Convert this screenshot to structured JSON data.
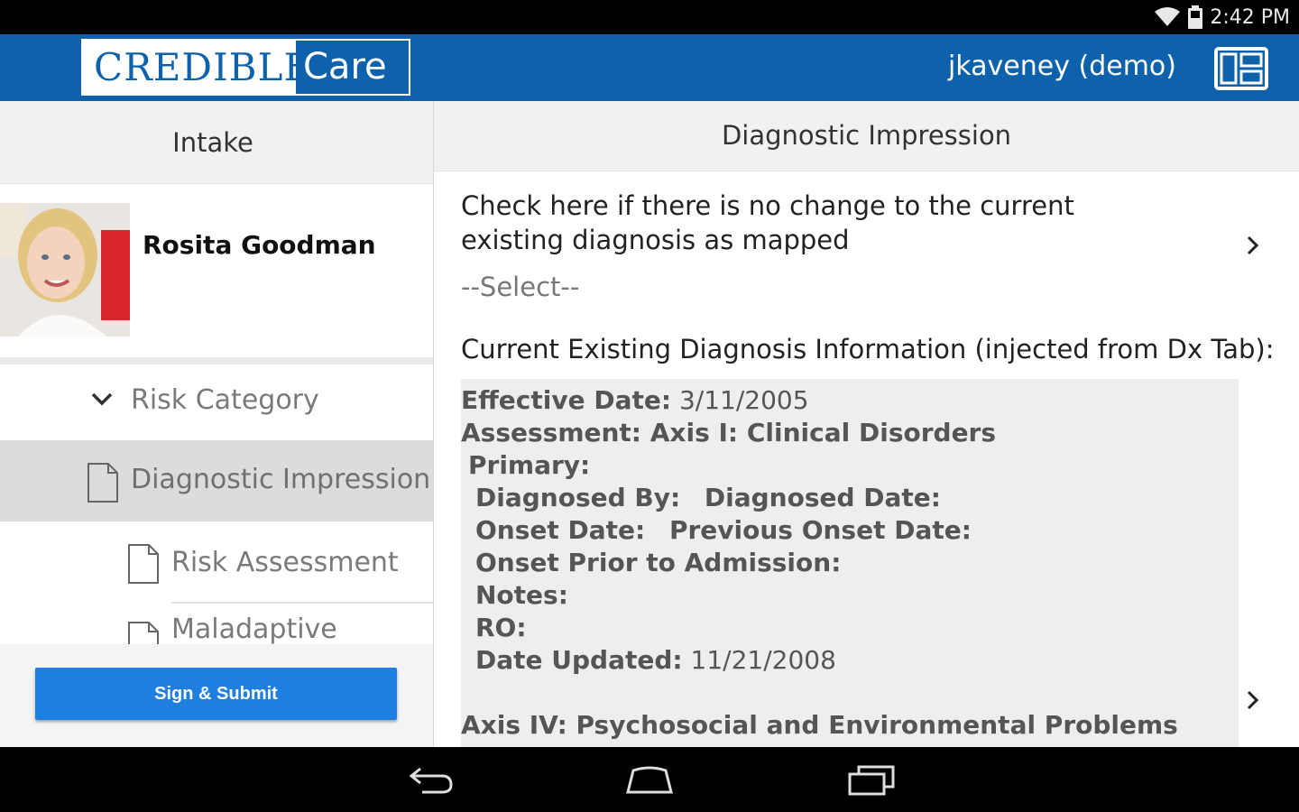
{
  "status_bar": {
    "time": "2:42 PM",
    "icons": [
      "wifi-icon",
      "battery-icon"
    ]
  },
  "app_bar": {
    "logo_left": "CREDIBLE",
    "logo_right": "Care",
    "username": "jkaveney (demo)",
    "layout_icon": "split-layout-icon"
  },
  "left_panel": {
    "header": "Intake",
    "patient": {
      "name": "Rosita Goodman"
    },
    "nav": [
      {
        "label": "Risk Category",
        "icon": "chevron-down-icon"
      },
      {
        "label": "Diagnostic Impression",
        "icon": "document-icon",
        "selected": true
      },
      {
        "label": "Risk Assessment",
        "icon": "document-icon"
      },
      {
        "label": "Maladaptive",
        "icon": "document-icon"
      }
    ],
    "submit_label": "Sign & Submit"
  },
  "right_panel": {
    "header": "Diagnostic Impression",
    "question": "Check here if there is no change to the current existing diagnosis as mapped",
    "select_value": "--Select--",
    "current_label": "Current Existing Diagnosis Information (injected from Dx Tab):",
    "dx": {
      "effective_label": "Effective Date:",
      "effective_value": "3/11/2005",
      "assessment": "Assessment: Axis I: Clinical Disorders",
      "primary": "Primary:",
      "diagnosed_by": "Diagnosed By:",
      "diagnosed_date": "Diagnosed Date:",
      "onset_date": "Onset Date:",
      "previous_onset": "Previous Onset Date:",
      "onset_prior": "Onset Prior to Admission:",
      "notes": "Notes:",
      "ro": "RO:",
      "updated_label": "Date Updated:",
      "updated_value": "11/21/2008",
      "axis4": "Axis IV: Psychosocial and Environmental Problems"
    }
  },
  "nav_bar": {
    "buttons": [
      "back-icon",
      "home-icon",
      "recents-icon"
    ]
  },
  "colors": {
    "brand_blue": "#0d62ab",
    "button_blue": "#1f7fe0",
    "selected_bg": "#dcdcdc"
  }
}
